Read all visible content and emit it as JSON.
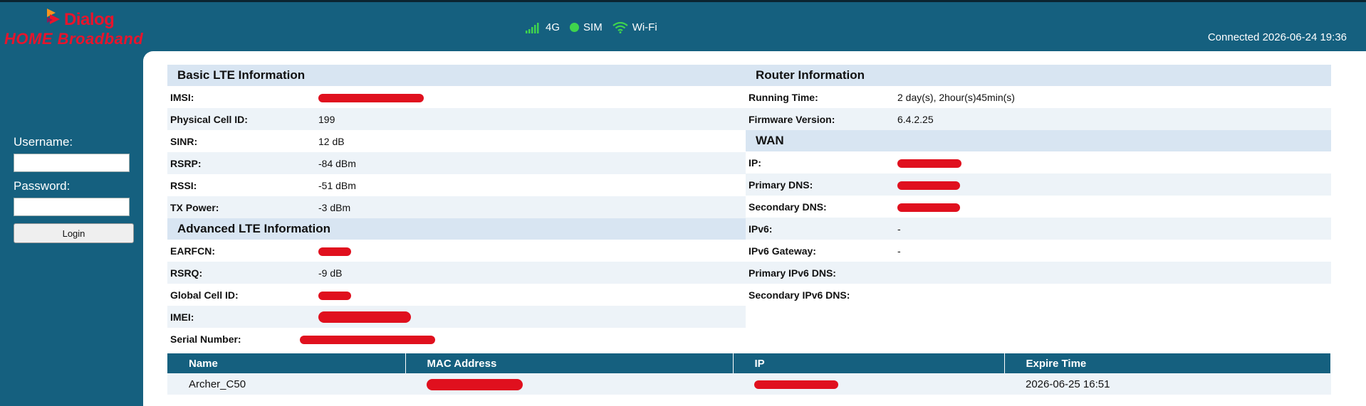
{
  "brand": {
    "line1": "Dialog",
    "line2": "HOME Broadband"
  },
  "status": {
    "network": "4G",
    "sim": "SIM",
    "wifi": "Wi-Fi",
    "connected": "Connected 2026-06-24 19:36"
  },
  "login": {
    "username_label": "Username:",
    "password_label": "Password:",
    "button": "Login"
  },
  "basic": {
    "title": "Basic LTE Information",
    "rows": [
      {
        "label": "IMSI:",
        "value": ""
      },
      {
        "label": "Physical Cell ID:",
        "value": "199"
      },
      {
        "label": "SINR:",
        "value": "12 dB"
      },
      {
        "label": "RSRP:",
        "value": "-84 dBm"
      },
      {
        "label": "RSSI:",
        "value": "-51 dBm"
      },
      {
        "label": "TX Power:",
        "value": "-3 dBm"
      }
    ]
  },
  "advanced": {
    "title": "Advanced LTE Information",
    "rows": [
      {
        "label": "EARFCN:",
        "value": ""
      },
      {
        "label": "RSRQ:",
        "value": "-9 dB"
      },
      {
        "label": "Global Cell ID:",
        "value": ""
      },
      {
        "label": "IMEI:",
        "value": ""
      },
      {
        "label": "Serial Number:",
        "value": ""
      }
    ]
  },
  "router": {
    "title": "Router Information",
    "rows": [
      {
        "label": "Running Time:",
        "value": "2 day(s), 2hour(s)45min(s)"
      },
      {
        "label": "Firmware Version:",
        "value": "6.4.2.25"
      }
    ]
  },
  "wan": {
    "title": "WAN",
    "rows": [
      {
        "label": "IP:",
        "value": ""
      },
      {
        "label": "Primary DNS:",
        "value": ""
      },
      {
        "label": "Secondary DNS:",
        "value": ""
      },
      {
        "label": "IPv6:",
        "value": "-"
      },
      {
        "label": "IPv6 Gateway:",
        "value": "-"
      },
      {
        "label": "Primary IPv6 DNS:",
        "value": ""
      },
      {
        "label": "Secondary IPv6 DNS:",
        "value": ""
      }
    ]
  },
  "dhcp": {
    "headers": [
      "Name",
      "MAC Address",
      "IP",
      "Expire Time"
    ],
    "rows": [
      {
        "name": "Archer_C50",
        "mac": "",
        "ip": "",
        "expire": "2026-06-25 16:51"
      }
    ]
  },
  "colors": {
    "header_bg": "#15607f",
    "section_bg": "#d8e5f2",
    "alt_row": "#edf3f8",
    "brand_red": "#e8142c",
    "redaction": "#e0101e"
  }
}
